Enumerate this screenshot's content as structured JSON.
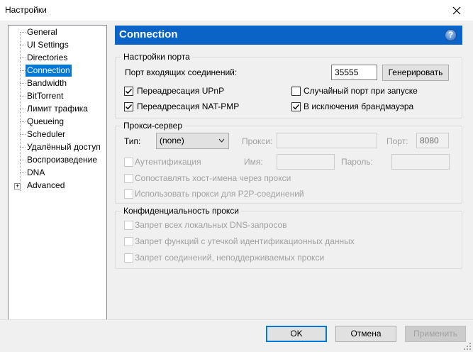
{
  "window": {
    "title": "Настройки"
  },
  "tree": {
    "items": [
      {
        "label": "General"
      },
      {
        "label": "UI Settings"
      },
      {
        "label": "Directories"
      },
      {
        "label": "Connection"
      },
      {
        "label": "Bandwidth"
      },
      {
        "label": "BitTorrent"
      },
      {
        "label": "Лимит трафика"
      },
      {
        "label": "Queueing"
      },
      {
        "label": "Scheduler"
      },
      {
        "label": "Удалённый доступ"
      },
      {
        "label": "Воспроизведение"
      },
      {
        "label": "DNA"
      },
      {
        "label": "Advanced"
      }
    ],
    "selected": "Connection"
  },
  "header": {
    "title": "Connection",
    "help_glyph": "?"
  },
  "port_settings": {
    "group_label": "Настройки порта",
    "incoming_port_label": "Порт входящих соединений:",
    "incoming_port_value": "35555",
    "generate_button": "Генерировать",
    "upnp_label": "Переадресация UPnP",
    "upnp_checked": true,
    "natpmp_label": "Переадресация NAT-PMP",
    "natpmp_checked": true,
    "random_port_label": "Случайный порт при запуске",
    "random_port_checked": false,
    "firewall_label": "В исключения брандмауэра",
    "firewall_checked": true
  },
  "proxy": {
    "group_label": "Прокси-сервер",
    "type_label": "Тип:",
    "type_value": "(none)",
    "proxy_label": "Прокси:",
    "proxy_value": "",
    "port_label": "Порт:",
    "port_value": "8080",
    "auth_label": "Аутентификация",
    "username_label": "Имя:",
    "username_value": "",
    "password_label": "Пароль:",
    "password_value": "",
    "resolve_hostnames_label": "Сопоставлять хост-имена через прокси",
    "p2p_label": "Использовать прокси для P2P-соединений"
  },
  "privacy": {
    "group_label": "Конфиденциальность прокси",
    "dns_label": "Запрет всех локальных DNS-запросов",
    "leak_label": "Запрет функций с утечкой идентификационных данных",
    "unsupported_label": "Запрет соединений, неподдерживаемых прокси"
  },
  "footer": {
    "ok_label": "OK",
    "cancel_label": "Отмена",
    "apply_label": "Применить"
  },
  "colors": {
    "accent": "#0078d7",
    "header_bg": "#0a64c8"
  }
}
